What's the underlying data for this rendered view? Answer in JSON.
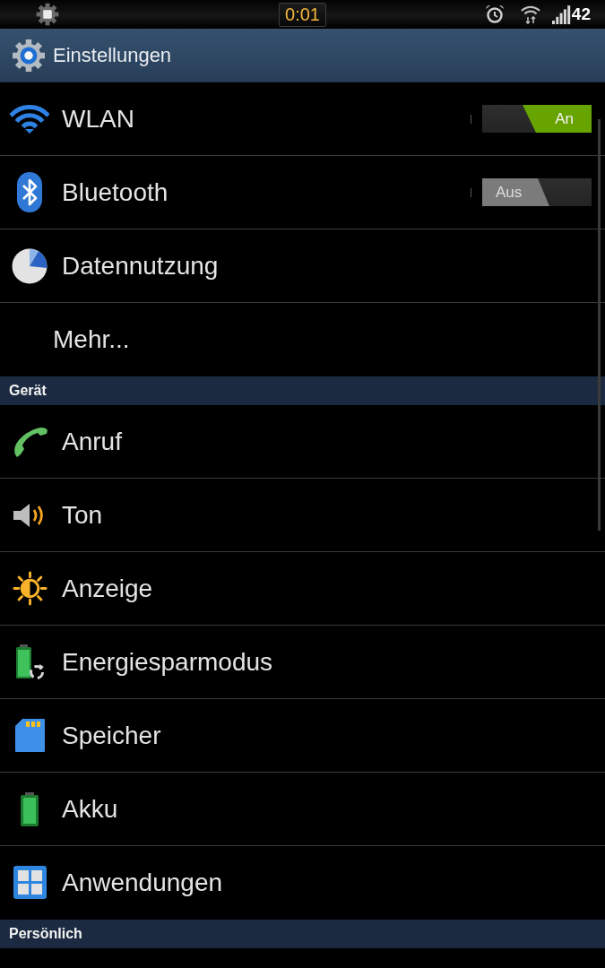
{
  "status_bar": {
    "clock": "0:01",
    "reading": "42"
  },
  "action_bar": {
    "title": "Einstellungen"
  },
  "sections": [
    {
      "items": [
        {
          "kind": "switch",
          "label": "WLAN",
          "switch": {
            "on": true,
            "label": "An"
          }
        },
        {
          "kind": "switch",
          "label": "Bluetooth",
          "switch": {
            "on": false,
            "label": "Aus"
          }
        },
        {
          "kind": "entry",
          "label": "Datennutzung"
        },
        {
          "kind": "more",
          "label": "Mehr..."
        }
      ]
    },
    {
      "header": "Gerät",
      "items": [
        {
          "kind": "entry",
          "label": "Anruf"
        },
        {
          "kind": "entry",
          "label": "Ton"
        },
        {
          "kind": "entry",
          "label": "Anzeige"
        },
        {
          "kind": "entry",
          "label": "Energiesparmodus"
        },
        {
          "kind": "entry",
          "label": "Speicher"
        },
        {
          "kind": "entry",
          "label": "Akku"
        },
        {
          "kind": "entry",
          "label": "Anwendungen"
        }
      ]
    },
    {
      "header": "Persönlich"
    }
  ]
}
